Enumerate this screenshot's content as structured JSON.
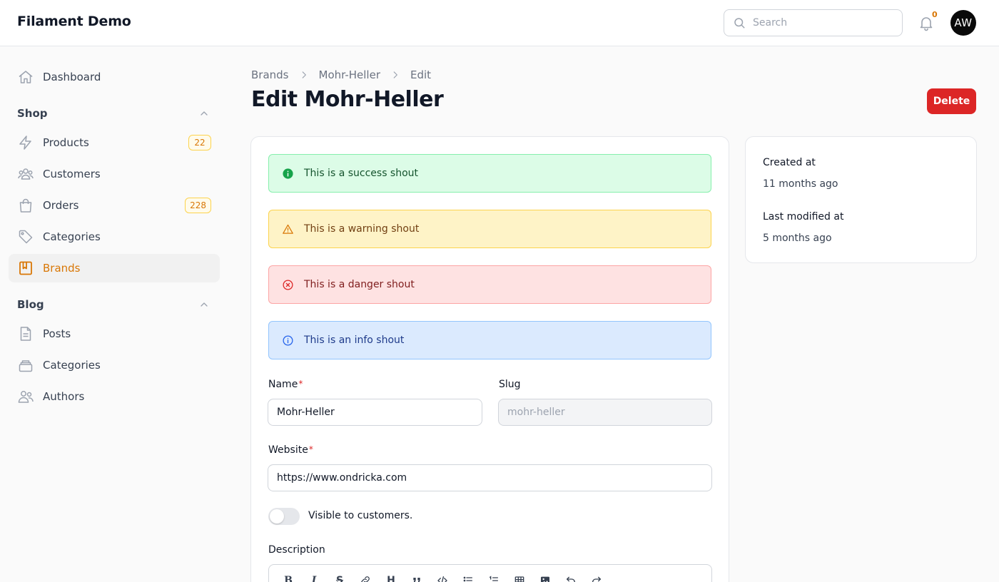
{
  "app": {
    "title": "Filament Demo"
  },
  "topbar": {
    "search_placeholder": "Search",
    "notification_count": "0",
    "avatar_initials": "AW"
  },
  "sidebar": {
    "dashboard": {
      "label": "Dashboard",
      "icon": "home-icon"
    },
    "groups": [
      {
        "label": "Shop",
        "items": [
          {
            "label": "Products",
            "icon": "bolt-icon",
            "badge": "22"
          },
          {
            "label": "Customers",
            "icon": "users-icon"
          },
          {
            "label": "Orders",
            "icon": "shopping-bag-icon",
            "badge": "228"
          },
          {
            "label": "Categories",
            "icon": "tag-icon"
          },
          {
            "label": "Brands",
            "icon": "book-icon",
            "active": true
          }
        ]
      },
      {
        "label": "Blog",
        "items": [
          {
            "label": "Posts",
            "icon": "document-icon"
          },
          {
            "label": "Categories",
            "icon": "stack-icon"
          },
          {
            "label": "Authors",
            "icon": "users-icon"
          }
        ]
      }
    ]
  },
  "breadcrumb": [
    "Brands",
    "Mohr-Heller",
    "Edit"
  ],
  "page": {
    "title": "Edit Mohr-Heller",
    "delete_label": "Delete"
  },
  "shouts": {
    "success": "This is a success shout",
    "warning": "This is a warning shout",
    "danger": "This is a danger shout",
    "info": "This is an info shout"
  },
  "form": {
    "name_label": "Name",
    "name_value": "Mohr-Heller",
    "slug_label": "Slug",
    "slug_value": "mohr-heller",
    "website_label": "Website",
    "website_value": "https://www.ondricka.com",
    "required_mark": "*",
    "visible_label": "Visible to customers.",
    "visible_on": false,
    "description_label": "Description"
  },
  "meta": {
    "created_label": "Created at",
    "created_value": "11 months ago",
    "modified_label": "Last modified at",
    "modified_value": "5 months ago"
  },
  "colors": {
    "primary": "#d97706",
    "danger": "#dc2626"
  }
}
